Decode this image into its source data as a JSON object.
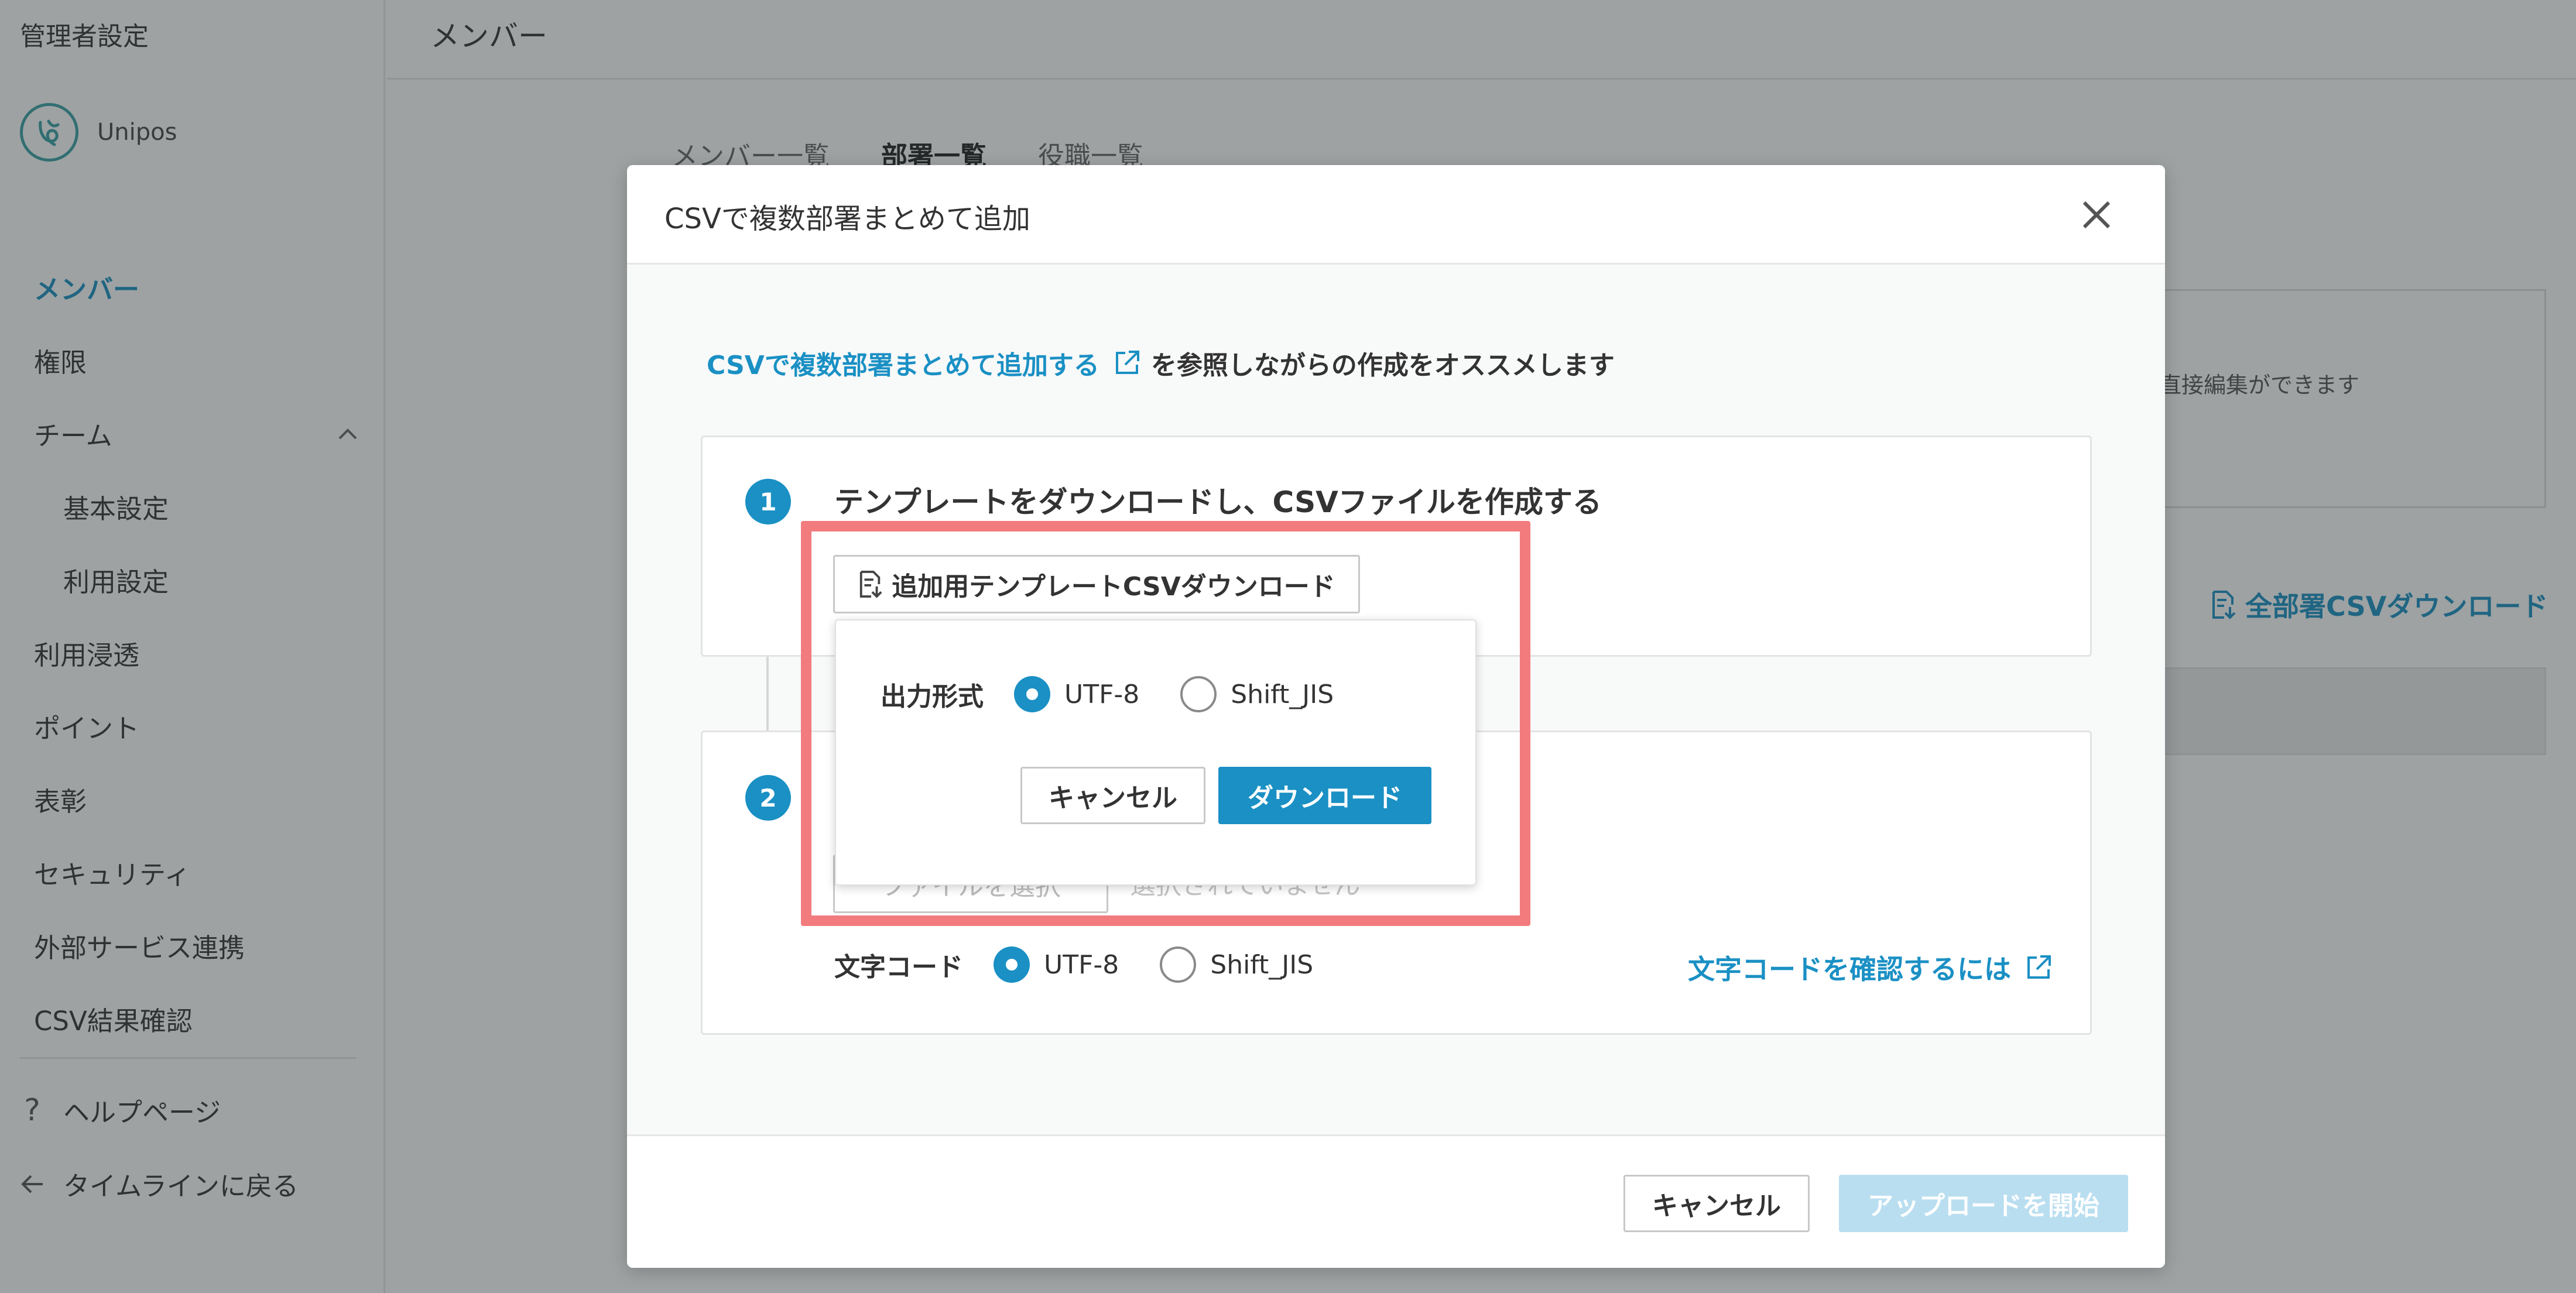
{
  "sidebar": {
    "title": "管理者設定",
    "brand": "Unipos",
    "items": [
      {
        "label": "メンバー",
        "active": true
      },
      {
        "label": "権限"
      },
      {
        "label": "チーム"
      },
      {
        "label": "基本設定"
      },
      {
        "label": "利用設定"
      },
      {
        "label": "利用浸透"
      },
      {
        "label": "ポイント"
      },
      {
        "label": "表彰"
      },
      {
        "label": "セキュリティ"
      },
      {
        "label": "外部サービス連携"
      },
      {
        "label": "CSV結果確認"
      }
    ],
    "help": "ヘルプページ",
    "back": "タイムラインに戻る"
  },
  "main": {
    "title": "メンバー",
    "tabs": [
      "メンバー一覧",
      "部署一覧",
      "役職一覧"
    ],
    "info_text": "直接編集ができます",
    "all_download": "全部署CSVダウンロード"
  },
  "modal": {
    "title": "CSVで複数部署まとめて追加",
    "intro_link": "CSVで複数部署まとめて追加する",
    "intro_rest": "を参照しながらの作成をオススメします",
    "step1": {
      "number": "1",
      "title": "テンプレートをダウンロードし、CSVファイルを作成する",
      "template_button": "追加用テンプレートCSVダウンロード"
    },
    "step2": {
      "number": "2",
      "file_button": "ファイルを選択",
      "file_hint": "選択されていません",
      "encoding_label": "文字コード",
      "encoding_options": [
        "UTF-8",
        "Shift_JIS"
      ],
      "encoding_selected": "UTF-8",
      "encoding_link": "文字コードを確認するには"
    },
    "popover": {
      "format_label": "出力形式",
      "options": [
        "UTF-8",
        "Shift_JIS"
      ],
      "selected": "UTF-8",
      "cancel": "キャンセル",
      "download": "ダウンロード"
    },
    "footer": {
      "cancel": "キャンセル",
      "start_upload": "アップロードを開始"
    }
  },
  "colors": {
    "accent": "#1a90c4",
    "highlight": "#f27b7d",
    "disabled_button": "#b9def0",
    "overlay": "rgba(40,48,50,0.45)"
  },
  "icons": [
    "logo-icon",
    "chevron-up-icon",
    "question-icon",
    "arrow-left-icon",
    "close-icon",
    "external-link-icon",
    "file-download-icon",
    "file-icon"
  ]
}
